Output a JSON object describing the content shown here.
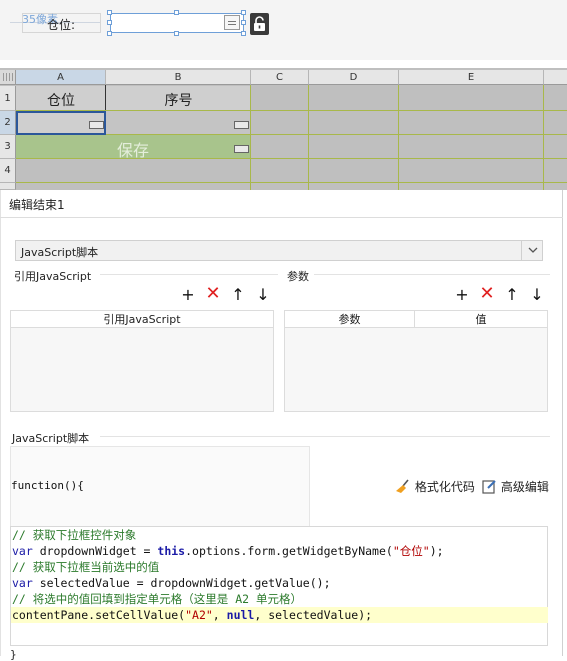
{
  "designer": {
    "ruler_tag": "35像素",
    "label_text": "仓位:",
    "lock_icon": "unlock-icon"
  },
  "sheet": {
    "columns": [
      "A",
      "B",
      "C",
      "D",
      "E"
    ],
    "rows": [
      "1",
      "2",
      "3",
      "4"
    ],
    "a1": "仓位",
    "b1": "序号",
    "save_text": "保存",
    "colors": {
      "grid": "#a8b84a",
      "save_bg": "#a8c48c",
      "sheet_bg": "#bfbfbf"
    }
  },
  "dialog": {
    "title": "编辑结束1",
    "script_type": "JavaScript脚本",
    "left_section": "引用JavaScript",
    "right_section": "参数",
    "left_table_header": "引用JavaScript",
    "right_table_headers": [
      "参数",
      "值"
    ],
    "toolbar_icons": [
      "plus-icon",
      "delete-icon",
      "arrow-up-icon",
      "arrow-down-icon"
    ],
    "script_section": "JavaScript脚本",
    "function_header": "function(){",
    "format_button": "格式化代码",
    "advanced_button": "高级编辑",
    "closing_brace": "}"
  },
  "code": {
    "comment1": "// 获取下拉框控件对象",
    "line2_var": "var",
    "line2_a": " dropdownWidget = ",
    "line2_this": "this",
    "line2_b": ".options.form.getWidgetByName(",
    "line2_str": "\"仓位\"",
    "line2_c": ");",
    "comment2": "// 获取下拉框当前选中的值",
    "line4_var": "var",
    "line4_rest": " selectedValue = dropdownWidget.getValue();",
    "comment3": "// 将选中的值回填到指定单元格（这里是 A2 单元格）",
    "line6_a": "contentPane.setCellValue(",
    "line6_str": "\"A2\"",
    "line6_b": ", ",
    "line6_null": "null",
    "line6_c": ", selectedValue);",
    "highlight_color": "#ffffcc"
  }
}
